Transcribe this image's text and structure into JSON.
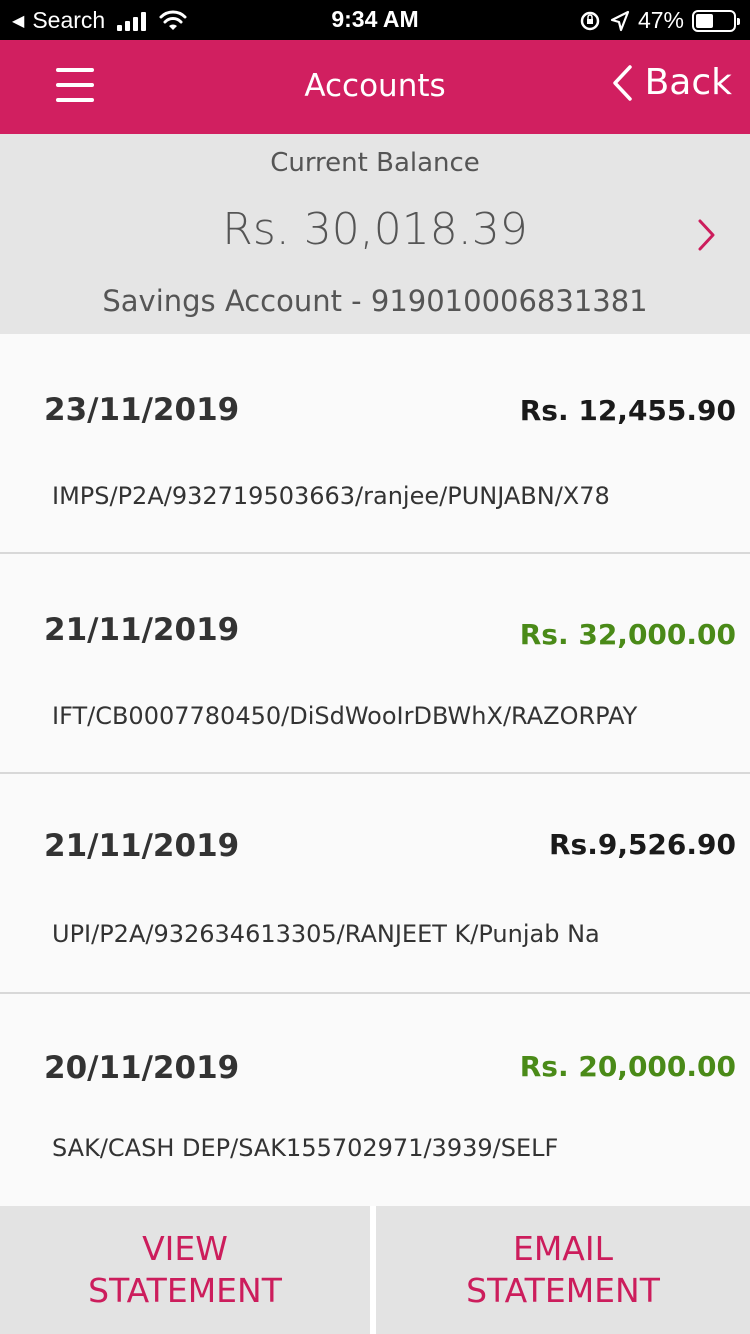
{
  "status_bar": {
    "back_app": "Search",
    "time": "9:34 AM",
    "battery": "47%",
    "signal_icon": "signal-bars-icon",
    "wifi_icon": "wifi-icon",
    "orientation_icon": "orientation-lock-icon",
    "location_icon": "location-arrow-icon",
    "battery_icon": "battery-icon",
    "battery_level": 0.47
  },
  "navbar": {
    "title": "Accounts",
    "back_label": "Back",
    "menu_icon": "hamburger-menu-icon",
    "back_icon": "chevron-left-icon",
    "color": "#d11f60"
  },
  "balance": {
    "caption": "Current Balance",
    "amount": "Rs. 30,018.39",
    "account": "Savings Account - 919010006831381",
    "detail_icon": "chevron-right-icon"
  },
  "transactions": [
    {
      "date": "23/11/2019",
      "amount": "Rs. 12,455.90",
      "type": "debit",
      "description": "IMPS/P2A/932719503663/ranjee/PUNJABN/X78"
    },
    {
      "date": "21/11/2019",
      "amount": "Rs. 32,000.00",
      "type": "credit",
      "description": "IFT/CB0007780450/DiSdWooIrDBWhX/RAZORPAY"
    },
    {
      "date": "21/11/2019",
      "amount": "Rs.9,526.90",
      "type": "debit",
      "description": "UPI/P2A/932634613305/RANJEET K/Punjab Na"
    },
    {
      "date": "20/11/2019",
      "amount": "Rs. 20,000.00",
      "type": "credit",
      "description": "SAK/CASH DEP/SAK155702971/3939/SELF"
    }
  ],
  "colors": {
    "brand": "#d11f60",
    "credit": "#4a8a18",
    "debit": "#1a1a1a"
  },
  "buttons": {
    "view_statement_line1": "VIEW",
    "view_statement_line2": "STATEMENT",
    "email_statement_line1": "EMAIL",
    "email_statement_line2": "STATEMENT"
  }
}
